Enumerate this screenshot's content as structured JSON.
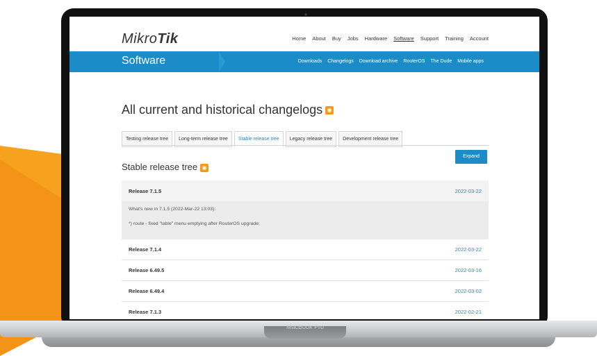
{
  "device": {
    "label": "MacBook Pro"
  },
  "header": {
    "logo_main": "Mikro",
    "logo_bold": "Tik",
    "nav": [
      "Home",
      "About",
      "Buy",
      "Jobs",
      "Hardware",
      "Software",
      "Support",
      "Training",
      "Account"
    ],
    "active_nav": "Software"
  },
  "subheader": {
    "title": "Software",
    "links": [
      "Downloads",
      "Changelogs",
      "Download archive",
      "RouterOS",
      "The Dude",
      "Mobile apps"
    ]
  },
  "main": {
    "title": "All current and historical changelogs",
    "tabs": [
      "Testing release tree",
      "Long-term release tree",
      "Stable release tree",
      "Legacy release tree",
      "Development release tree"
    ],
    "active_tab": "Stable release tree",
    "section_title": "Stable release tree",
    "expand_label": "Expand",
    "releases": [
      {
        "name": "Release 7.1.5",
        "date": "2022-03-22",
        "expanded": true,
        "body_heading": "What's new in 7.1.5 (2022-Mar-22 13:03):",
        "body_items": [
          "*) route - fixed \"table\" menu emptying after RouterOS upgrade;"
        ]
      },
      {
        "name": "Release 7.1.4",
        "date": "2022-03-22"
      },
      {
        "name": "Release 6.49.5",
        "date": "2022-03-16"
      },
      {
        "name": "Release 6.49.4",
        "date": "2022-03-02"
      },
      {
        "name": "Release 7.1.3",
        "date": "2022-02-21"
      }
    ]
  },
  "colors": {
    "accent": "#1b8cc7",
    "rss": "#f39a1a",
    "background_shape": "#f6a21e"
  }
}
